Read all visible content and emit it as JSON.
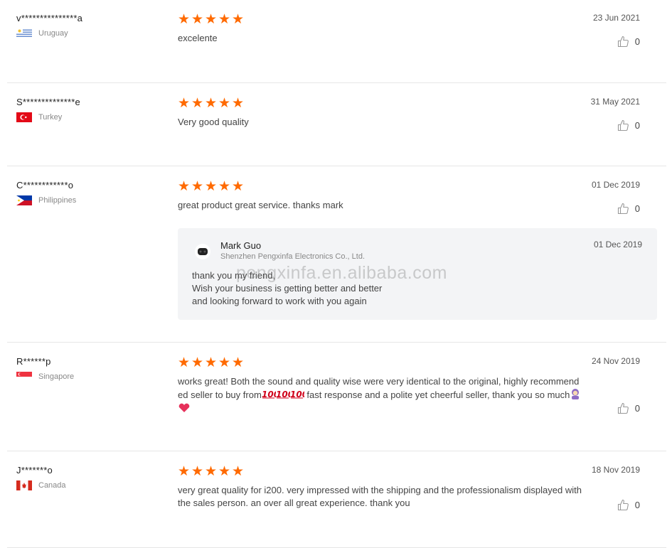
{
  "reviews": [
    {
      "username": "v***************a",
      "country": "Uruguay",
      "stars": "★★★★★",
      "text": "excelente",
      "date": "23 Jun 2021",
      "likes": "0"
    },
    {
      "username": "S**************e",
      "country": "Turkey",
      "stars": "★★★★★",
      "text": "Very good quality",
      "date": "31 May 2021",
      "likes": "0"
    },
    {
      "username": "C************o",
      "country": "Philippines",
      "stars": "★★★★★",
      "text": "great product great service. thanks mark",
      "date": "01 Dec 2019",
      "likes": "0",
      "reply": {
        "seller_name": "Mark Guo",
        "company": "Shenzhen Pengxinfa Electronics Co., Ltd.",
        "date": "01 Dec 2019",
        "line1": "thank you my friend,",
        "line2": "Wish your business is getting better and better",
        "line3": "and looking forward to work with you again"
      }
    },
    {
      "username": "R******p",
      "country": "Singapore",
      "stars": "★★★★★",
      "text_part1": "works great! Both the sound and quality wise were very identical to the original, highly recommended seller to buy from",
      "text_part2": " fast response and a polite yet cheerful seller, thank you so much",
      "date": "24 Nov 2019",
      "likes": "0"
    },
    {
      "username": "J*******o",
      "country": "Canada",
      "stars": "★★★★★",
      "text": "very great quality for i200. very impressed with the shipping and the professionalism displayed with the sales person. an over all great experience. thank you",
      "date": "18 Nov 2019",
      "likes": "0"
    }
  ],
  "watermark": "pengxinfa.en.alibaba.com",
  "colors": {
    "star": "#ff6a00",
    "divider": "#e6e6e6",
    "reply_bg": "#f3f4f6"
  },
  "icons": {
    "like": "thumbs-up-icon",
    "seller_logo": "earbuds-icon"
  }
}
